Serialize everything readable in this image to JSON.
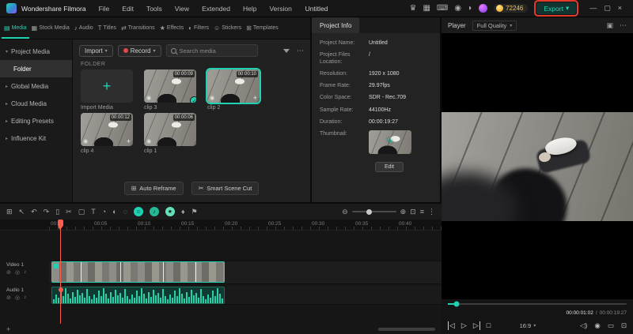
{
  "colors": {
    "accent": "#1fd3b2",
    "playhead": "#ff5c50",
    "export_highlight": "#e23b2e"
  },
  "icons": {
    "chevron_down": "▾",
    "chevron_right": "▸",
    "tab_media": "▤",
    "tab_stock": "▦",
    "tab_audio": "♪",
    "tab_titles": "T",
    "tab_transitions": "⇄",
    "tab_effects": "★",
    "tab_filters": "◐",
    "tab_stickers": "☺",
    "tab_templates": "⊞",
    "record_dot": "",
    "more_h": "⋯",
    "more_v": "⋮",
    "plus": "+",
    "check": "✓",
    "camera_clip": "◉",
    "premium": "♛",
    "layout": "▦",
    "keyboard": "⌨",
    "capture": "◉",
    "bell": "◗",
    "minimize": "—",
    "restore": "▢",
    "close": "×",
    "auto_reframe": "⊞",
    "scene_cut": "✂",
    "edit_pencil": "✎",
    "grid": "⊞",
    "pointer": "↖",
    "undo": "↶",
    "redo": "↷",
    "trash": "▯",
    "split": "✂",
    "crop": "▢",
    "text_tool": "T",
    "speed": "◔",
    "color": "◐",
    "mask": "◌",
    "ai_smile": "☺",
    "ai_audio": "♪",
    "ai_star": "★",
    "mic": "♦",
    "marker": "⚑",
    "zoom_out": "⊖",
    "zoom_in": "⊕",
    "fit": "⊡",
    "mixer": "≡",
    "step_back": "◁",
    "play": "▷",
    "step_fwd": "▷",
    "stop": "□",
    "volume": "◁)",
    "snapshot": "◉",
    "display": "▭",
    "fullscreen": "⊡",
    "detach": "▣",
    "track_lock": "⊘",
    "track_rec": "◉",
    "track_hide": "◎",
    "track_mute": "♪"
  },
  "header": {
    "brand": "Wondershare Filmora",
    "menus": [
      "File",
      "Edit",
      "Tools",
      "View",
      "Extended",
      "Help",
      "Version"
    ],
    "title": "Untitled",
    "coins": "72246",
    "export_label": "Export"
  },
  "asset_tabs": [
    {
      "label": "Media"
    },
    {
      "label": "Stock Media"
    },
    {
      "label": "Audio"
    },
    {
      "label": "Titles"
    },
    {
      "label": "Transitions"
    },
    {
      "label": "Effects"
    },
    {
      "label": "Filters"
    },
    {
      "label": "Stickers"
    },
    {
      "label": "Templates"
    }
  ],
  "sidebar": {
    "items": [
      {
        "label": "Project Media"
      },
      {
        "label": "Folder"
      },
      {
        "label": "Global Media"
      },
      {
        "label": "Cloud Media"
      },
      {
        "label": "Editing Presets"
      },
      {
        "label": "Influence Kit"
      }
    ]
  },
  "media": {
    "import_label": "Import",
    "record_label": "Record",
    "search_placeholder": "Search media",
    "folder_label": "FOLDER",
    "import_tile_label": "Import Media",
    "clips": [
      {
        "name": "clip 3",
        "duration": "00:00:09"
      },
      {
        "name": "clip 2",
        "duration": "00:00:10"
      },
      {
        "name": "clip 4",
        "duration": "00:00:12"
      },
      {
        "name": "clip 1",
        "duration": "00:00:06"
      }
    ],
    "actions": [
      {
        "label": "Auto Reframe"
      },
      {
        "label": "Smart Scene Cut"
      }
    ]
  },
  "project_info": {
    "tab_label": "Project Info",
    "fields": [
      {
        "label": "Project Name:",
        "value": "Untitled"
      },
      {
        "label": "Project Files Location:",
        "value": "/"
      },
      {
        "label": "Resolution:",
        "value": "1920 x 1080"
      },
      {
        "label": "Frame Rate:",
        "value": "29.97fps"
      },
      {
        "label": "Color Space:",
        "value": "SDR - Rec.709"
      },
      {
        "label": "Sample Rate:",
        "value": "44100Hz"
      },
      {
        "label": "Duration:",
        "value": "00:00:19:27"
      }
    ],
    "thumbnail_label": "Thumbnail:",
    "edit_label": "Edit"
  },
  "player": {
    "label": "Player",
    "quality": "Full Quality",
    "current_time": "00:00:01:02",
    "time_separator": "/",
    "total_time": "00:00:19:27",
    "aspect": "16:9"
  },
  "timeline": {
    "ruler": [
      "00:00",
      "00:05",
      "00:10",
      "00:15",
      "00:20",
      "00:25",
      "00:30",
      "00:35",
      "00:40"
    ],
    "tracks": [
      {
        "name": "Video 1"
      },
      {
        "name": "Audio 1"
      }
    ]
  }
}
